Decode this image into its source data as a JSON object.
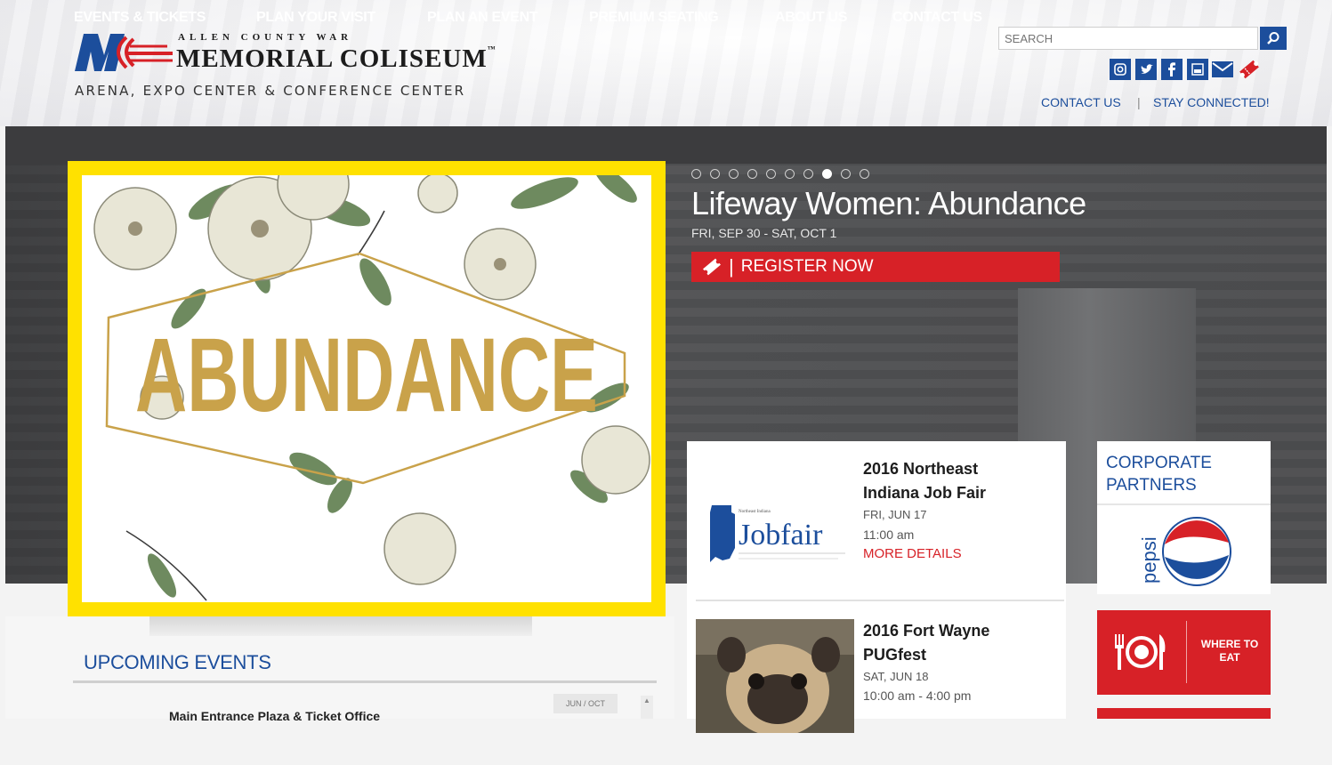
{
  "header": {
    "logo_top": "ALLEN COUNTY WAR",
    "logo_main": "MEMORIAL COLISEUM",
    "logo_tm": "™",
    "logo_sub": "ARENA, EXPO CENTER & CONFERENCE CENTER",
    "search_placeholder": "SEARCH",
    "social_icons": [
      "instagram-icon",
      "twitter-icon",
      "facebook-icon",
      "youtube-icon",
      "email-icon",
      "ticket-icon"
    ],
    "contact_us": "CONTACT US",
    "separator": "|",
    "stay_connected": "STAY CONNECTED!"
  },
  "nav": {
    "items": [
      "EVENTS & TICKETS",
      "PLAN YOUR VISIT",
      "PLAN AN EVENT",
      "PREMIUM SEATING",
      "ABOUT US",
      "CONTACT US"
    ]
  },
  "hero": {
    "image_text": "ABUNDANCE",
    "slide_count": 10,
    "active_slide": 8,
    "title": "Lifeway Women: Abundance",
    "date": "FRI, SEP 30 - SAT, OCT 1",
    "cta": "REGISTER NOW",
    "cta_separator": "|"
  },
  "events": [
    {
      "thumb_text": "Jobfair",
      "name_line1": "2016 Northeast",
      "name_line2": "Indiana Job Fair",
      "date": "FRI, JUN 17",
      "time": "11:00 am",
      "more": "MORE DETAILS"
    },
    {
      "name_line1": "2016 Fort Wayne",
      "name_line2": "PUGfest",
      "date": "SAT, JUN 18",
      "time": "10:00 am - 4:00 pm"
    }
  ],
  "sidebar": {
    "partners_title": "CORPORATE PARTNERS",
    "partner_logo_text": "pepsi",
    "where_to_eat": "WHERE TO EAT"
  },
  "upcoming": {
    "title": "UPCOMING EVENTS",
    "first_item": "Main Entrance Plaza & Ticket Office",
    "date_tab": "JUN / OCT",
    "scroll_arrow": "▲"
  },
  "colors": {
    "brand_blue": "#1c4e9c",
    "brand_red": "#d72127",
    "nav_bg": "#3c3c3e",
    "highlight": "#ffe100",
    "abundance_gold": "#c9a24a"
  }
}
